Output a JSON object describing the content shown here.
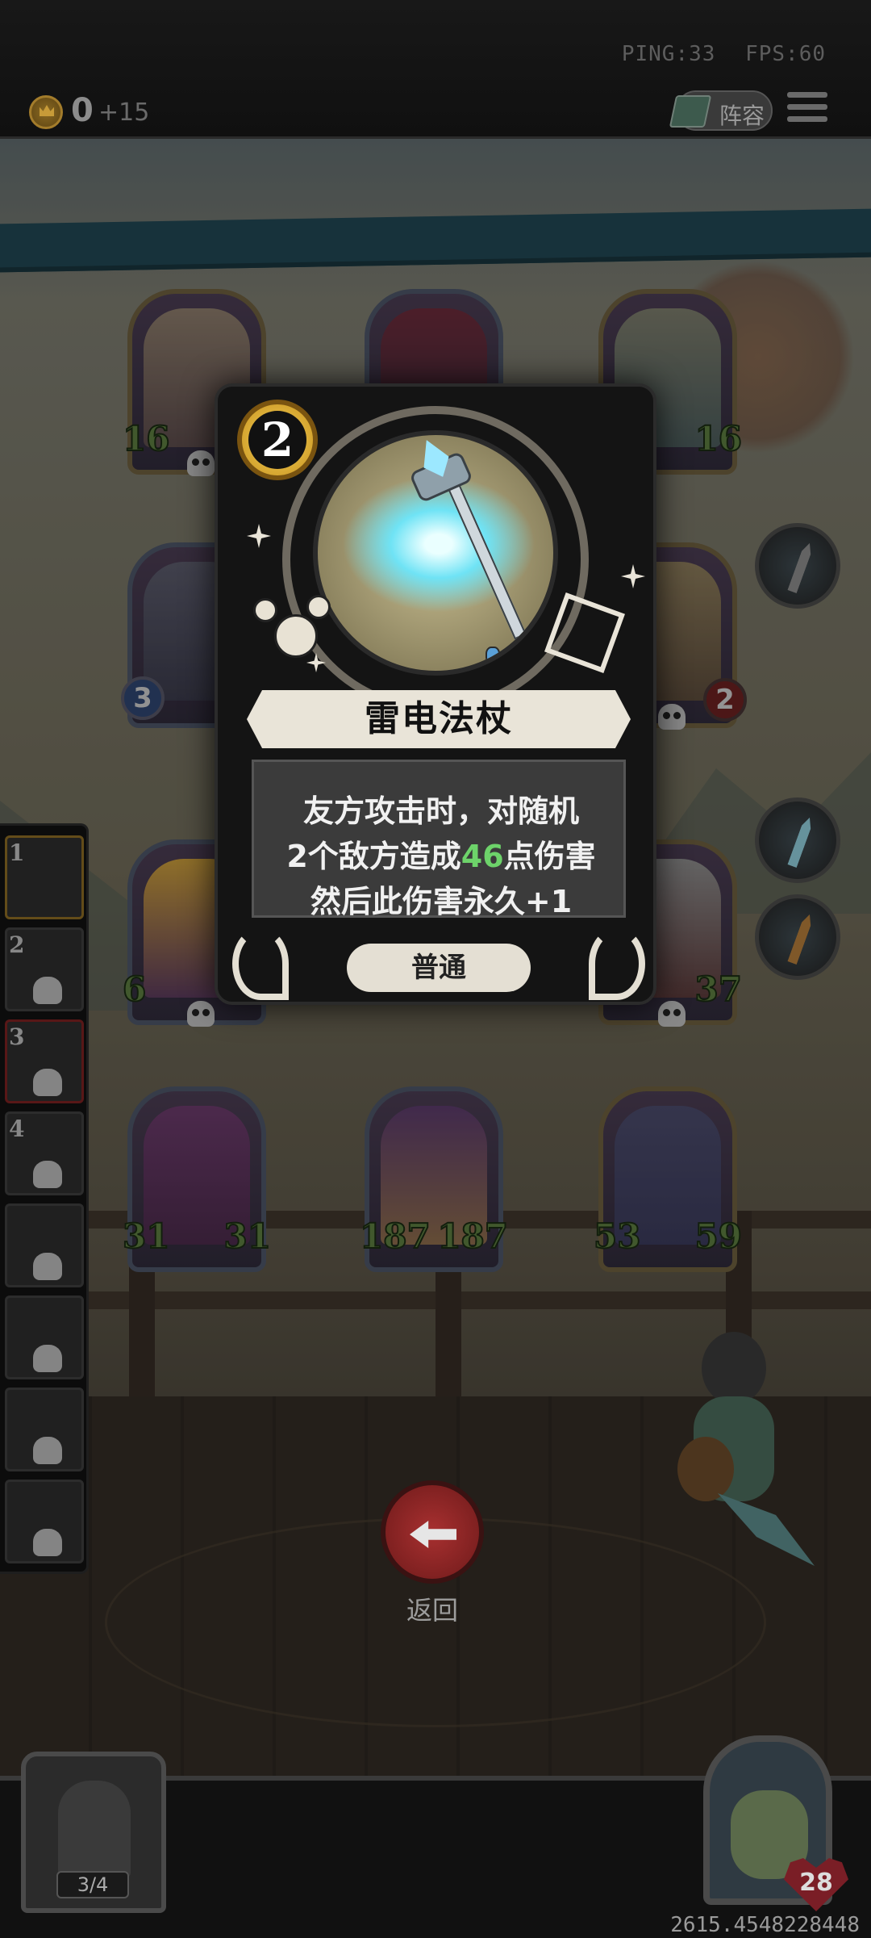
{
  "hud": {
    "ping": "PING:33",
    "fps": "FPS:60",
    "gold": "0",
    "gold_income": "+15",
    "lineup_label": "阵容"
  },
  "board": {
    "row1": [
      {
        "atk": "16",
        "hp": ""
      },
      {
        "atk": "",
        "hp": ""
      },
      {
        "atk": "",
        "hp": "16"
      }
    ],
    "row2_left_level": "3",
    "row2_right_hp": "2",
    "row3": [
      {
        "atk": "6",
        "hp": ""
      },
      {
        "atk": "",
        "hp": "37"
      }
    ],
    "row4": [
      {
        "atk": "31",
        "hp": "31"
      },
      {
        "atk": "187",
        "hp": "187"
      },
      {
        "atk": "53",
        "hp": "59"
      }
    ]
  },
  "roster": [
    "1",
    "2",
    "3",
    "4"
  ],
  "card": {
    "cost": "2",
    "name": "雷电法杖",
    "desc_line1": "友方攻击时，对随机",
    "desc_line2_a": "2个敌方造成",
    "desc_line2_value": "46",
    "desc_line2_b": "点伤害",
    "desc_line3": "然后此伤害永久+1",
    "rarity": "普通",
    "highlight_color": "#6dd36a"
  },
  "bottom": {
    "back_label": "返回",
    "chest_count": "3/4",
    "health": "28",
    "coords": "2615.4548228448"
  }
}
